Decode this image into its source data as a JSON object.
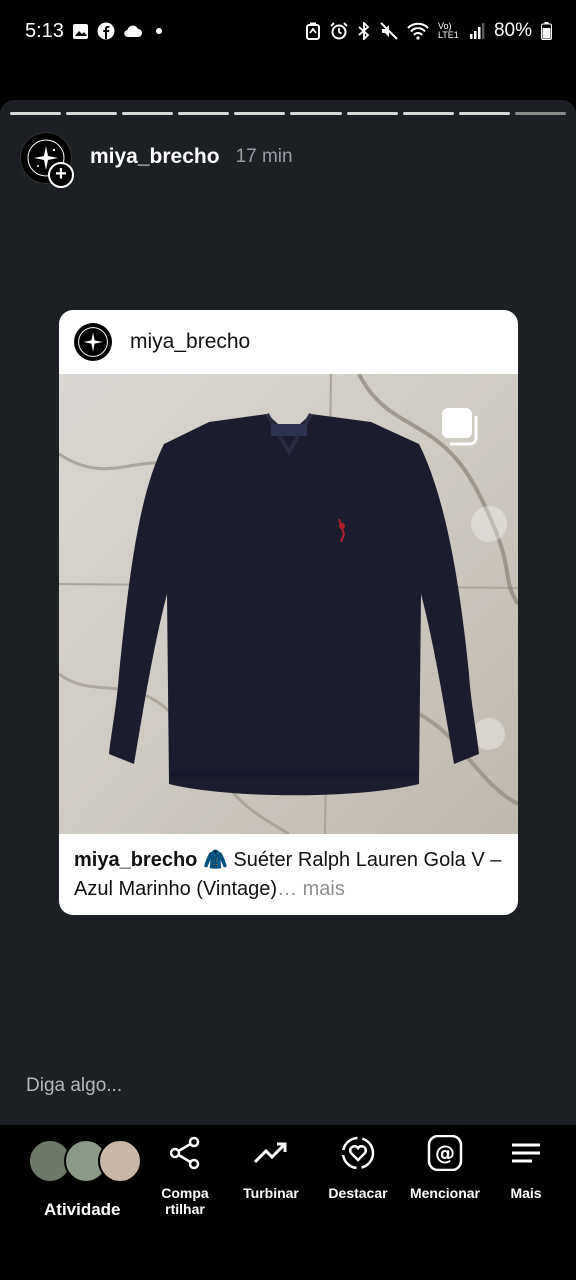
{
  "status_bar": {
    "time": "5:13",
    "battery": "80%",
    "network": "Vo) LTE1",
    "left_icons": [
      "gallery-icon",
      "facebook-icon",
      "cloud-icon",
      "dot-icon"
    ],
    "right_icons": [
      "battery-saver-icon",
      "alarm-icon",
      "bluetooth-icon",
      "mute-icon",
      "wifi-icon",
      "signal-icon",
      "battery-icon"
    ]
  },
  "story": {
    "username": "miya_brecho",
    "time_ago": "17 min",
    "segments_total": 10
  },
  "post": {
    "username": "miya_brecho",
    "caption_user": "miya_brecho",
    "caption_emoji": "🧥",
    "caption_text": " Suéter Ralph Lauren Gola V – Azul Marinho (Vintage)",
    "caption_more": "… mais"
  },
  "reply": {
    "placeholder": "Diga algo..."
  },
  "bottom_bar": {
    "activity_label": "Atividade",
    "share_label": "Compa\nrtilhar",
    "boost_label": "Turbinar",
    "highlight_label": "Destacar",
    "mention_label": "Mencionar",
    "more_label": "Mais"
  },
  "colors": {
    "story_bg": "#1c1f24",
    "sweater": "#1b1d2e",
    "muted_text": "#9a9da3"
  }
}
